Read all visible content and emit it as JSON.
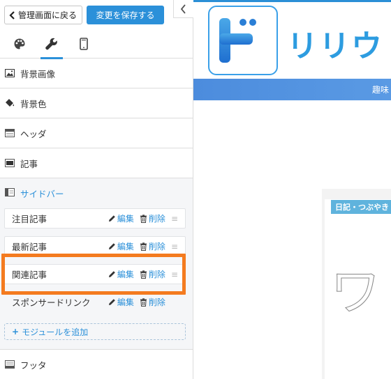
{
  "toolbar": {
    "back_label": "管理画面に戻る",
    "save_label": "変更を保存する"
  },
  "tabs": [
    {
      "name": "palette-icon",
      "active": false
    },
    {
      "name": "wrench-icon",
      "active": true
    },
    {
      "name": "mobile-icon",
      "active": false
    }
  ],
  "sections": {
    "bg_image": "背景画像",
    "bg_color": "背景色",
    "header": "ヘッダ",
    "article": "記事",
    "sidebar": "サイドバー",
    "footer": "フッタ"
  },
  "modules": [
    {
      "name": "注目記事",
      "edit": "編集",
      "delete": "削除"
    },
    {
      "name": "最新記事",
      "edit": "編集",
      "delete": "削除"
    },
    {
      "name": "関連記事",
      "edit": "編集",
      "delete": "削除"
    },
    {
      "name": "スポンサードリンク",
      "edit": "編集",
      "delete": "削除"
    }
  ],
  "add_module_label": "モジュールを追加",
  "preview": {
    "logo_mark": "ド",
    "logo_text": "リリウ",
    "nav_text": "趣味",
    "tag": "日記・つぶやき",
    "big_text": "ワ"
  },
  "colors": {
    "accent": "#2b90d9",
    "highlight": "#f47b1f"
  }
}
